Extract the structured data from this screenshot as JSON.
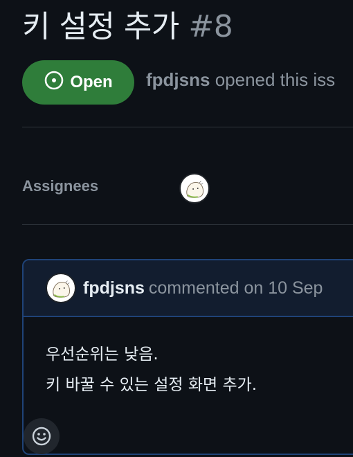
{
  "issue": {
    "title": "키 설정 추가",
    "number": "#8",
    "state": "Open",
    "author": "fpdjsns",
    "opened_text": "opened this iss"
  },
  "sidebar": {
    "assignees_label": "Assignees"
  },
  "comment": {
    "author": "fpdjsns",
    "meta": "commented on 10 Sep",
    "body_lines": [
      "우선순위는 낮음.",
      "키 바꿀 수 있는 설정 화면 추가."
    ]
  },
  "icons": {
    "state": "issue-opened-icon",
    "reaction": "smiley-icon",
    "avatar": "avatar-image"
  },
  "colors": {
    "background": "#0d1117",
    "open_badge": "#2f7d3a",
    "comment_border": "#1f4378",
    "comment_header": "#121d2f",
    "muted_text": "#8b949e"
  }
}
